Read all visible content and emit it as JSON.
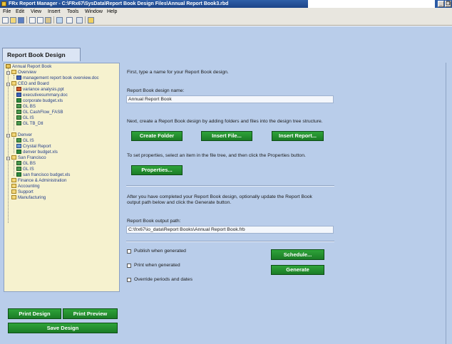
{
  "window": {
    "title": "FRx Report Manager - C:\\FRx67\\SysData\\Report Book Design Files\\Annual Report Book3.rbd",
    "controls": [
      "_",
      "❐",
      "x"
    ]
  },
  "menu": [
    "File",
    "Edit",
    "View",
    "Insert",
    "Tools",
    "Window",
    "Help"
  ],
  "toolbar": {
    "icons": [
      "new-icon",
      "open-icon",
      "save-icon",
      "cut-icon",
      "copy-icon",
      "paste-icon",
      "brush-icon",
      "grid-icon",
      "print-icon",
      "catalog-icon"
    ]
  },
  "tab": {
    "label": "Report Book Design"
  },
  "tree": {
    "items": [
      {
        "label": "Annual Report Book",
        "icon": "book-icon"
      },
      {
        "label": "Overview",
        "icon": "folder-icon"
      },
      {
        "label": "management report book overview.doc",
        "icon": "word-icon"
      },
      {
        "label": "CEO and Board",
        "icon": "folder-icon"
      },
      {
        "label": "variance analysis.ppt",
        "icon": "powerpoint-icon"
      },
      {
        "label": "executivesummary.doc",
        "icon": "word-icon"
      },
      {
        "label": "corporate budget.xls",
        "icon": "excel-icon"
      },
      {
        "label": "GL BS",
        "icon": "report-icon"
      },
      {
        "label": "GL CashFlow_FASB",
        "icon": "report-icon"
      },
      {
        "label": "GL IS",
        "icon": "report-icon"
      },
      {
        "label": "GL TB_Dtl",
        "icon": "report-icon"
      },
      {
        "label": "Denver",
        "icon": "folder-icon"
      },
      {
        "label": "GL IS",
        "icon": "report-icon"
      },
      {
        "label": "Crystal Report",
        "icon": "crystal-icon"
      },
      {
        "label": "denver budget.xls",
        "icon": "excel-icon"
      },
      {
        "label": "San Francisco",
        "icon": "folder-icon"
      },
      {
        "label": "GL BS",
        "icon": "report-icon"
      },
      {
        "label": "GL IS",
        "icon": "report-icon"
      },
      {
        "label": "san francisco budget.xls",
        "icon": "excel-icon"
      },
      {
        "label": "Finance & Administration",
        "icon": "folder-icon"
      },
      {
        "label": "Accounting",
        "icon": "folder-icon"
      },
      {
        "label": "Support",
        "icon": "folder-icon"
      },
      {
        "label": "Manufacturing",
        "icon": "folder-icon"
      }
    ]
  },
  "leftButtons": {
    "print_design": "Print Design",
    "print_preview": "Print Preview",
    "save_design": "Save Design"
  },
  "main": {
    "intro": "First, type a name for your Report Book design.",
    "name_label": "Report Book design name:",
    "name_value": "Annual Report Book",
    "create_text": "Next, create a Report Book design by adding folders and files into the design tree structure.",
    "create_folder": "Create Folder",
    "insert_file": "Insert File...",
    "insert_report": "Insert Report...",
    "properties_text": "To set properties, select an item in the file tree, and then click the Properties button.",
    "properties": "Properties...",
    "after_text_1": "After you have completed your Report Book design, optionally update the Report Book",
    "after_text_2": "output path below and click the Generate button.",
    "output_label": "Report Book output path:",
    "output_value": "C:\\frx67\\io_data\\Report Books\\Annual Report Book.frb",
    "publish": "Publish when generated",
    "print": "Print when generated",
    "override": "Override periods and dates",
    "schedule": "Schedule...",
    "generate": "Generate"
  },
  "colors": {
    "background": "#b9cdea",
    "tree_background": "#f6f2cf",
    "button_green": "#1f8a2c",
    "title_blue": "#1c4488"
  }
}
